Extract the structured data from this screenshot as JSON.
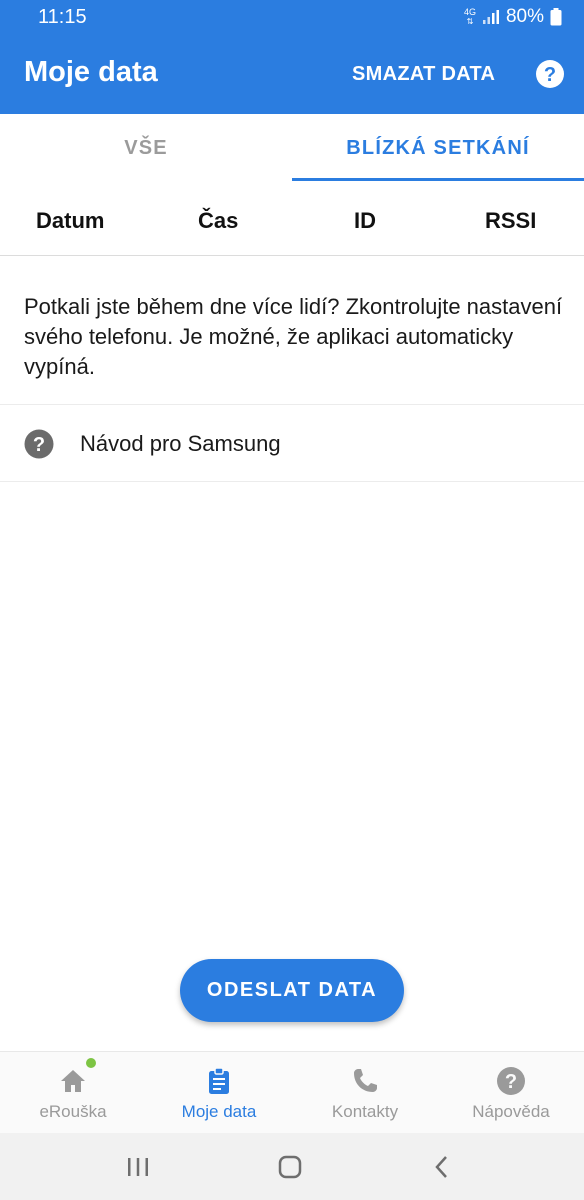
{
  "status_bar": {
    "time": "11:15",
    "network": "4G",
    "battery": "80%"
  },
  "app_bar": {
    "title": "Moje data",
    "action": "SMAZAT DATA",
    "help_icon": "help-circle-icon"
  },
  "tabs": [
    {
      "label": "VŠE",
      "active": false
    },
    {
      "label": "BLÍZKÁ SETKÁNÍ",
      "active": true
    }
  ],
  "table_headers": [
    "Datum",
    "Čas",
    "ID",
    "RSSI"
  ],
  "info_text": "Potkali jste během dne více lidí? Zkontrolujte nastavení svého telefonu. Je možné, že aplikaci automaticky vypíná.",
  "guide": {
    "label": "Návod pro Samsung",
    "icon": "help-circle-icon"
  },
  "send_button": "ODESLAT DATA",
  "bottom_nav": [
    {
      "label": "eRouška",
      "icon": "home-icon",
      "active": false,
      "badge": true
    },
    {
      "label": "Moje data",
      "icon": "clipboard-icon",
      "active": true
    },
    {
      "label": "Kontakty",
      "icon": "phone-icon",
      "active": false
    },
    {
      "label": "Nápověda",
      "icon": "help-circle-icon",
      "active": false
    }
  ],
  "colors": {
    "primary": "#2b7de0",
    "badge": "#7dc443",
    "inactive": "#9a9a9a"
  }
}
